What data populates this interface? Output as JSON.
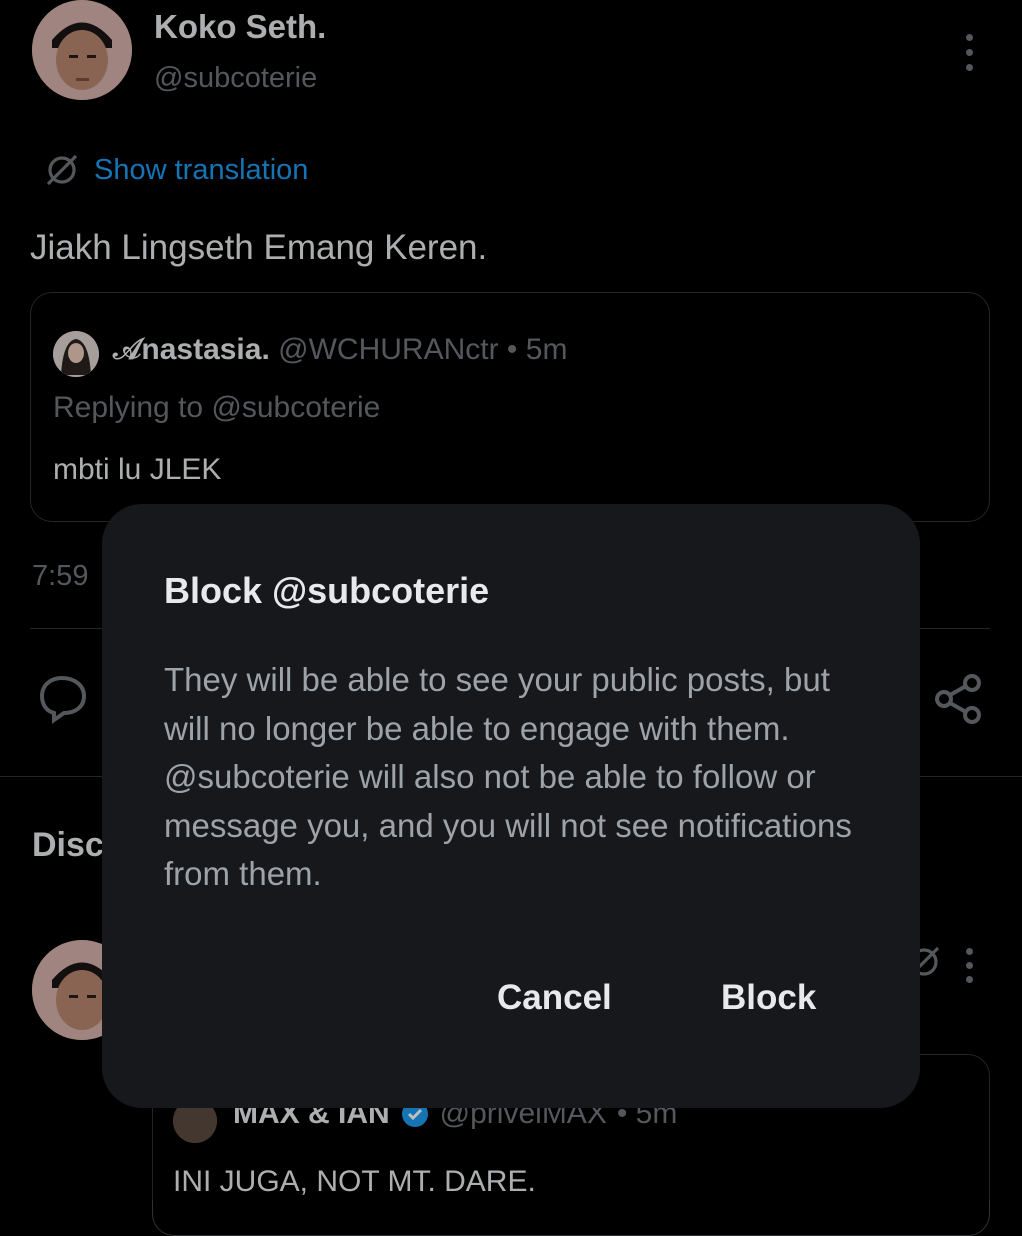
{
  "tweet": {
    "author_name": "Koko Seth.",
    "author_handle": "@subcoterie",
    "show_translation": "Show translation",
    "text": "Jiakh Lingseth Emang Keren.",
    "time_partial": "7:59"
  },
  "quote": {
    "author_name": "𝒜nastasia.",
    "author_handle": "@WCHURANctr",
    "time": "• 5m",
    "replying_to": "Replying to @subcoterie",
    "text": "mbti lu JLEK"
  },
  "section_partial": "Disc",
  "second_post": {
    "quote_name": "MAX & IAN",
    "quote_handle": "@privelMAX",
    "quote_time": "• 5m",
    "quote_text": "INI JUGA, NOT MT. DARE."
  },
  "modal": {
    "title": "Block @subcoterie",
    "body": "They will be able to see your public posts, but will no longer be able to engage with them. @subcoterie will also not be able to follow or message you, and you will not see notifications from them.",
    "cancel_label": "Cancel",
    "block_label": "Block"
  },
  "colors": {
    "background": "#000000",
    "link_blue": "#1d9bf0",
    "modal_bg": "#17181c",
    "muted_text": "#71767b"
  },
  "icons": [
    "translate-icon",
    "more-options-icon",
    "reply-icon",
    "share-icon",
    "verified-badge-icon"
  ]
}
